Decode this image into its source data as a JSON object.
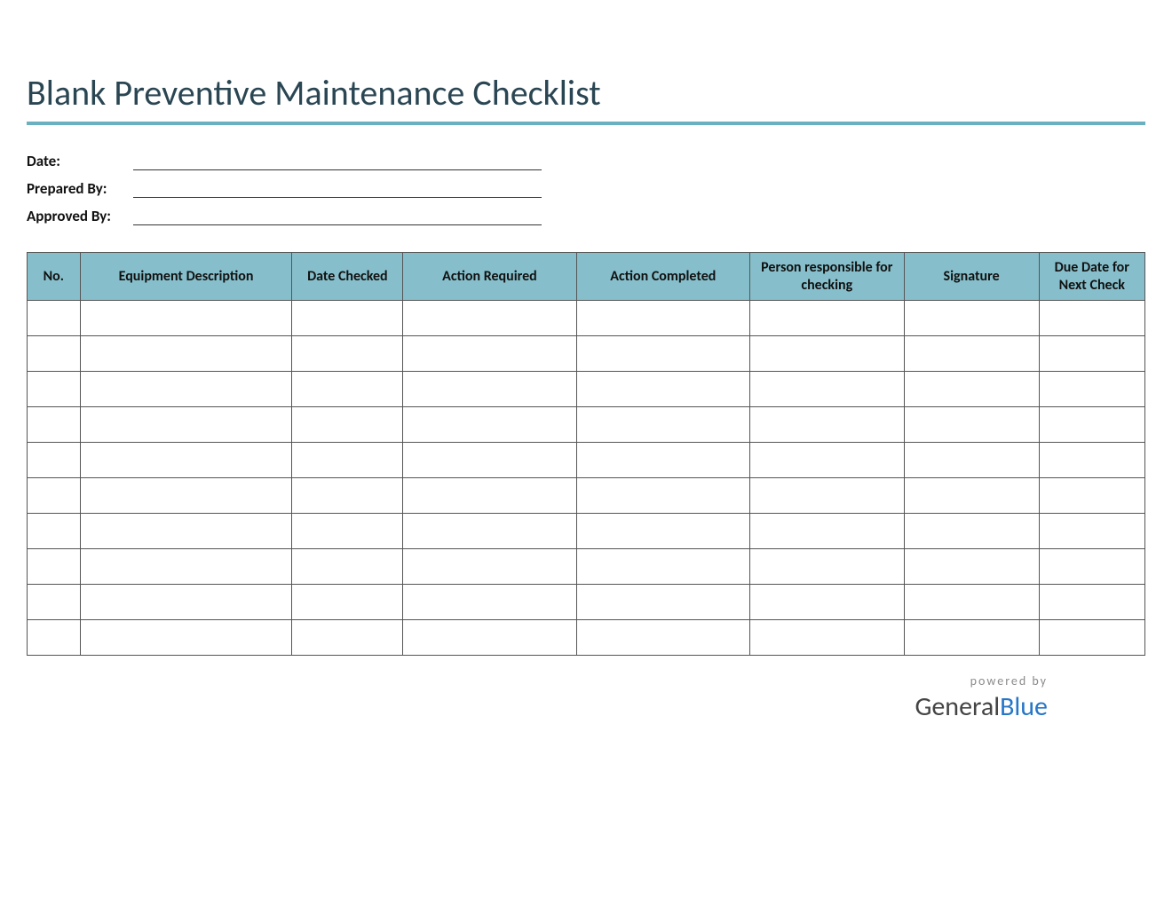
{
  "title": "Blank Preventive Maintenance Checklist",
  "meta": {
    "date_label": "Date:",
    "prepared_by_label": "Prepared By:",
    "approved_by_label": "Approved By:",
    "date_value": "",
    "prepared_by_value": "",
    "approved_by_value": ""
  },
  "columns": [
    "No.",
    "Equipment Description",
    "Date Checked",
    "Action Required",
    "Action Completed",
    "Person responsible for checking",
    "Signature",
    "Due Date for Next Check"
  ],
  "row_count": 10,
  "footer": {
    "powered_by": "powered by",
    "brand_part1": "General",
    "brand_part2": "Blue"
  }
}
